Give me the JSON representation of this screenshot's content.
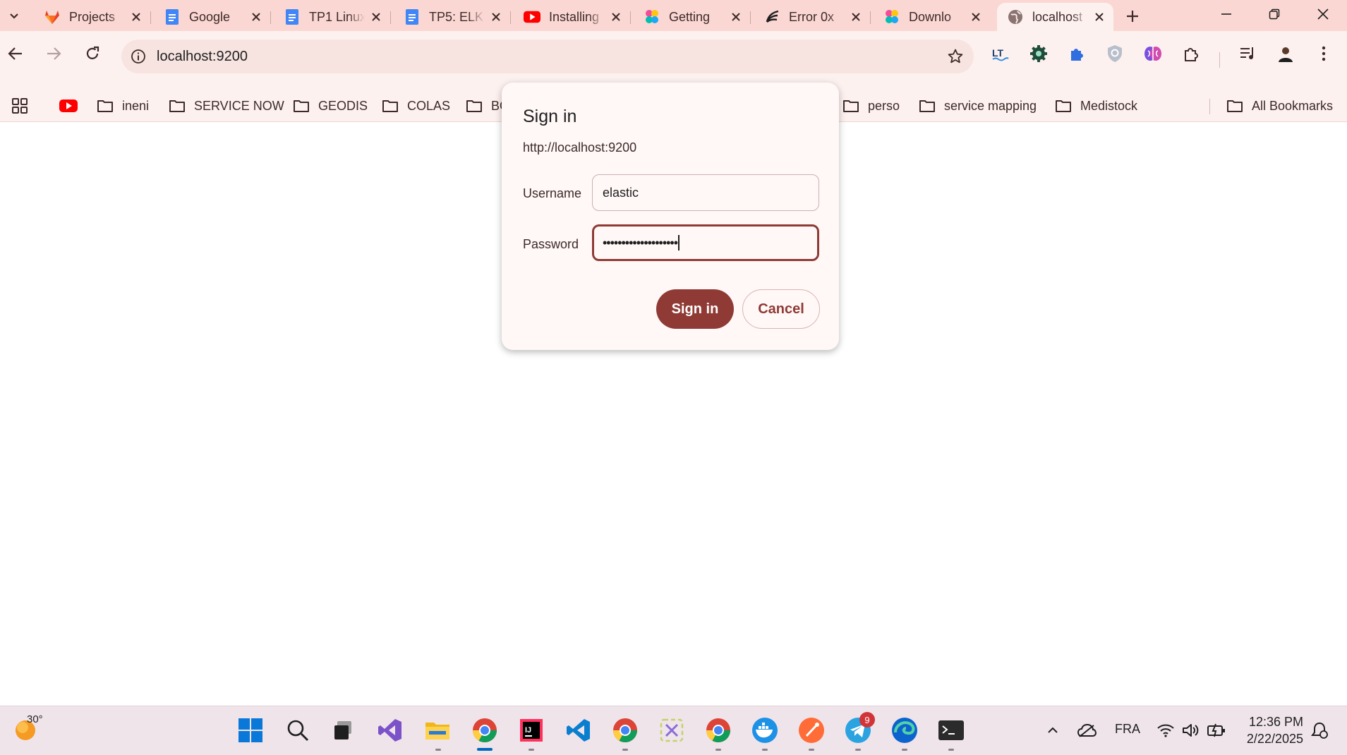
{
  "tabs": [
    {
      "title": "Projects",
      "icon": "gitlab-icon"
    },
    {
      "title": "Google",
      "icon": "google-docs-icon"
    },
    {
      "title": "TP1 Linux",
      "icon": "google-docs-icon"
    },
    {
      "title": "TP5: ELK",
      "icon": "google-docs-icon"
    },
    {
      "title": "Installing",
      "icon": "youtube-icon"
    },
    {
      "title": "Getting",
      "icon": "elastic-icon"
    },
    {
      "title": "Error 0x",
      "icon": "stackoverflow-icon"
    },
    {
      "title": "Downlo",
      "icon": "elastic-icon"
    },
    {
      "title": "localhost",
      "icon": "globe-icon",
      "active": true
    }
  ],
  "address_bar": {
    "url": "localhost:9200"
  },
  "bookmarks": [
    {
      "label": "ineni"
    },
    {
      "label": "SERVICE NOW"
    },
    {
      "label": "GEODIS"
    },
    {
      "label": "COLAS"
    },
    {
      "label": "BO"
    },
    {
      "label": "perso"
    },
    {
      "label": "service mapping"
    },
    {
      "label": "Medistock"
    },
    {
      "label": "All Bookmarks"
    }
  ],
  "dialog": {
    "title": "Sign in",
    "origin": "http://localhost:9200",
    "username_label": "Username",
    "username_value": "elastic",
    "password_label": "Password",
    "password_value": "••••••••••••••••••••",
    "signin_label": "Sign in",
    "cancel_label": "Cancel"
  },
  "taskbar": {
    "weather_temp": "30°",
    "language": "FRA",
    "time": "12:36 PM",
    "date": "2/22/2025",
    "telegram_badge": "9"
  },
  "colors": {
    "accent": "#8f3a35",
    "tabstrip": "#fbd7d3",
    "toolbar": "#fdf1ef"
  }
}
